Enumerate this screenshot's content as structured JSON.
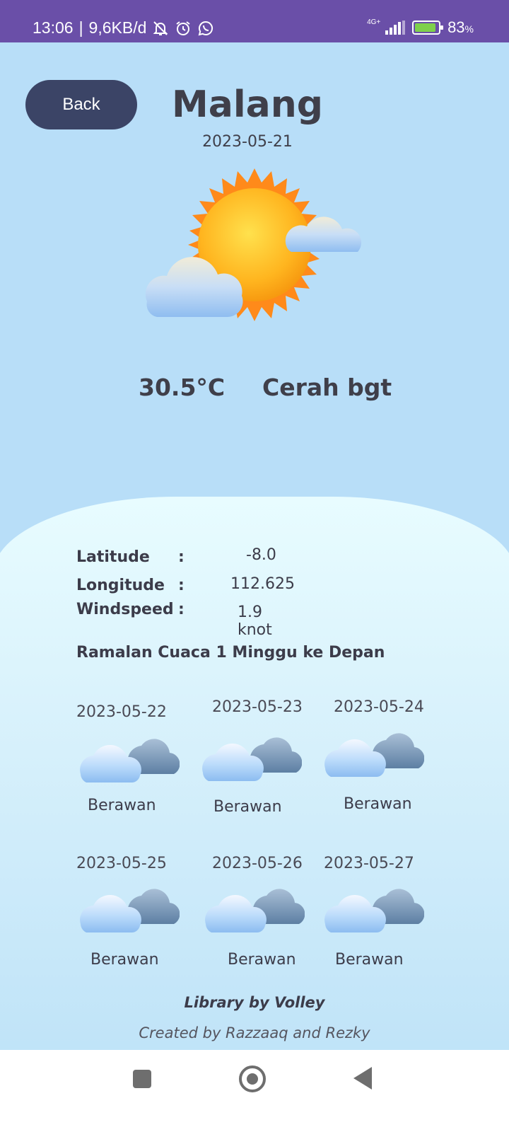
{
  "status_bar": {
    "time": "13:06",
    "net_speed": "9,6KB/d",
    "network_type": "4G+",
    "battery_percent": "83",
    "battery_unit": "%"
  },
  "header": {
    "back_label": "Back",
    "city": "Malang",
    "date": "2023-05-21"
  },
  "current": {
    "temperature": "30.5°C",
    "condition": "Cerah bgt",
    "icon": "sun-cloud-icon"
  },
  "details": {
    "latitude_label": "Latitude",
    "latitude_value": "-8.0",
    "longitude_label": "Longitude",
    "longitude_value": "112.625",
    "windspeed_label": "Windspeed",
    "windspeed_value": "1.9 knot",
    "separator": ":"
  },
  "forecast": {
    "title": "Ramalan Cuaca 1 Minggu ke Depan",
    "days": [
      {
        "date": "2023-05-22",
        "condition": "Berawan",
        "icon": "cloudy-icon"
      },
      {
        "date": "2023-05-23",
        "condition": "Berawan",
        "icon": "cloudy-icon"
      },
      {
        "date": "2023-05-24",
        "condition": "Berawan",
        "icon": "cloudy-icon"
      },
      {
        "date": "2023-05-25",
        "condition": "Berawan",
        "icon": "cloudy-icon"
      },
      {
        "date": "2023-05-26",
        "condition": "Berawan",
        "icon": "cloudy-icon"
      },
      {
        "date": "2023-05-27",
        "condition": "Berawan",
        "icon": "cloudy-icon"
      }
    ]
  },
  "footer": {
    "library": "Library by Volley",
    "authors": "Created by Razzaaq and Rezky"
  },
  "colors": {
    "status_bar": "#6a4fa8",
    "background": "#b8def8",
    "back_button": "#3b4466",
    "text": "#3f3f4a"
  }
}
